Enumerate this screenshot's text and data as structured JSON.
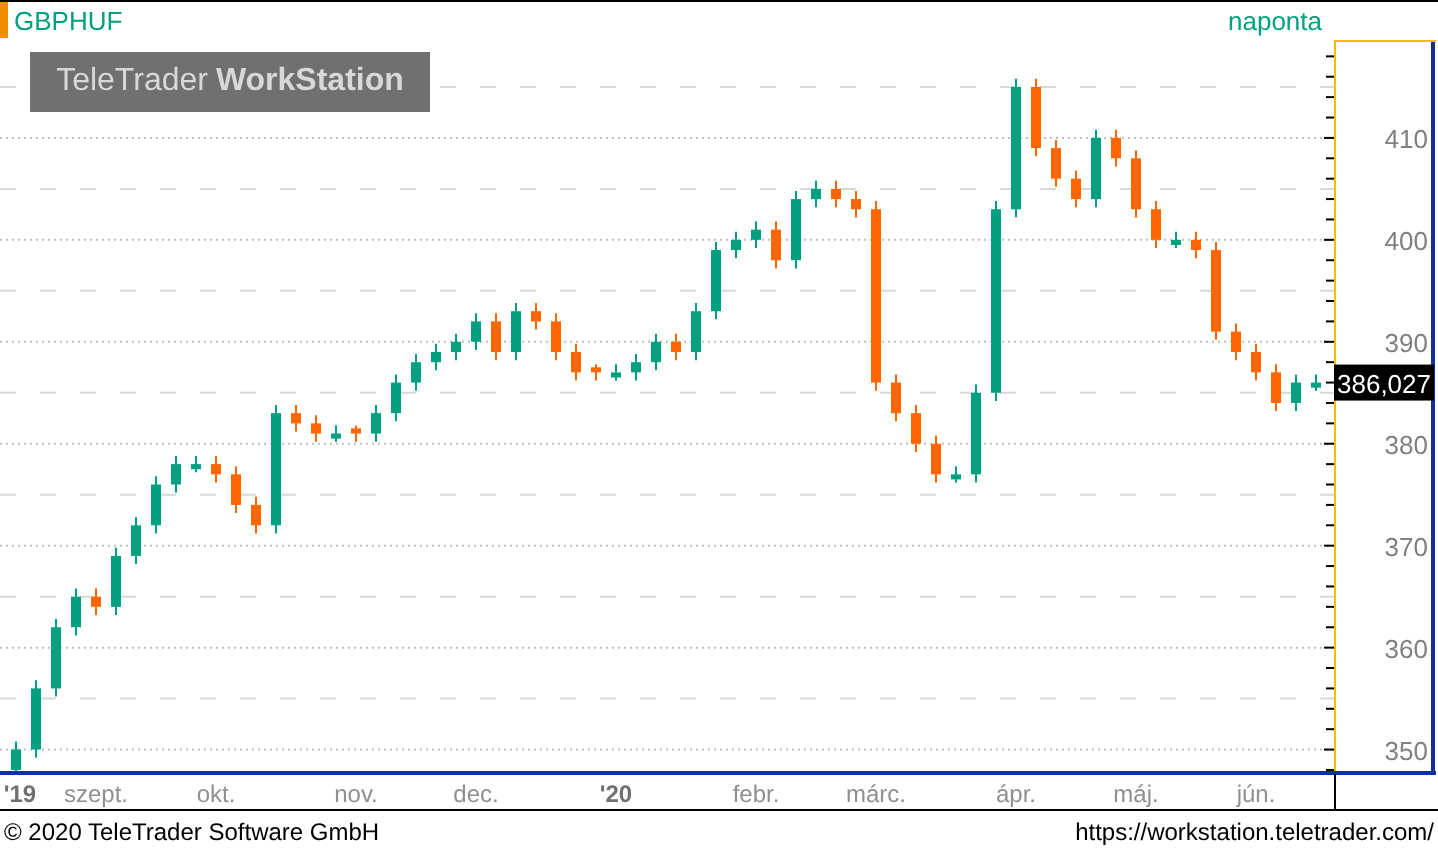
{
  "header": {
    "symbol": "GBPHUF",
    "interval": "naponta",
    "logo": {
      "brand": "TeleTrader",
      "product": "WorkStation"
    }
  },
  "chart": {
    "last_price": "386,027",
    "chart_data": {
      "type": "candlestick",
      "grid": true,
      "categories": [
        "'19",
        null,
        null,
        null,
        "szept.",
        null,
        null,
        null,
        null,
        null,
        "okt.",
        null,
        null,
        null,
        null,
        null,
        null,
        "nov.",
        null,
        null,
        null,
        null,
        null,
        "dec.",
        null,
        null,
        null,
        null,
        null,
        null,
        "'20",
        null,
        null,
        null,
        null,
        null,
        null,
        "febr.",
        null,
        null,
        null,
        null,
        null,
        "márc.",
        null,
        null,
        null,
        null,
        null,
        null,
        "ápr.",
        null,
        null,
        null,
        null,
        null,
        "máj.",
        null,
        null,
        null,
        null,
        null,
        "jún.",
        null,
        null,
        null
      ],
      "ohlc": [
        [
          348,
          350.8,
          347.8,
          350
        ],
        [
          350,
          356.8,
          349.2,
          356
        ],
        [
          356,
          362.8,
          355.2,
          362
        ],
        [
          362,
          365.8,
          361.2,
          365
        ],
        [
          365,
          365.8,
          363.2,
          364
        ],
        [
          364,
          369.8,
          363.2,
          369
        ],
        [
          369,
          372.8,
          368.2,
          372
        ],
        [
          372,
          376.8,
          371.2,
          376
        ],
        [
          376,
          378.8,
          375.2,
          378
        ],
        [
          377.5,
          378.8,
          377.2,
          378
        ],
        [
          378,
          378.8,
          376.2,
          377
        ],
        [
          377,
          377.8,
          373.2,
          374
        ],
        [
          374,
          374.8,
          371.2,
          372
        ],
        [
          372,
          383.8,
          371.2,
          383
        ],
        [
          383,
          383.8,
          381.2,
          382
        ],
        [
          382,
          382.8,
          380.2,
          381
        ],
        [
          380.5,
          381.8,
          380.2,
          381
        ],
        [
          381.5,
          381.8,
          380.2,
          381
        ],
        [
          381,
          383.8,
          380.2,
          383
        ],
        [
          383,
          386.8,
          382.2,
          386
        ],
        [
          386,
          388.8,
          385.2,
          388
        ],
        [
          388,
          389.8,
          387.2,
          389
        ],
        [
          389,
          390.8,
          388.2,
          390
        ],
        [
          390,
          392.8,
          389.2,
          392
        ],
        [
          392,
          392.8,
          388.2,
          389
        ],
        [
          389,
          393.8,
          388.2,
          393
        ],
        [
          393,
          393.8,
          391.2,
          392
        ],
        [
          392,
          392.8,
          388.2,
          389
        ],
        [
          389,
          389.8,
          386.2,
          387
        ],
        [
          387.5,
          387.8,
          386.2,
          387
        ],
        [
          386.5,
          387.8,
          386.2,
          387
        ],
        [
          387,
          388.8,
          386.2,
          388
        ],
        [
          388,
          390.8,
          387.2,
          390
        ],
        [
          390,
          390.8,
          388.2,
          389
        ],
        [
          389,
          393.8,
          388.2,
          393
        ],
        [
          393,
          399.8,
          392.2,
          399
        ],
        [
          399,
          400.8,
          398.2,
          400
        ],
        [
          400,
          401.8,
          399.2,
          401
        ],
        [
          401,
          401.8,
          397.2,
          398
        ],
        [
          398,
          404.8,
          397.2,
          404
        ],
        [
          404,
          405.8,
          403.2,
          405
        ],
        [
          405,
          405.8,
          403.2,
          404
        ],
        [
          404,
          404.8,
          402.2,
          403
        ],
        [
          403,
          403.8,
          385.2,
          386
        ],
        [
          386,
          386.8,
          382.2,
          383
        ],
        [
          383,
          383.8,
          379.2,
          380
        ],
        [
          380,
          380.8,
          376.2,
          377
        ],
        [
          376.5,
          377.8,
          376.2,
          377
        ],
        [
          377,
          385.8,
          376.2,
          385
        ],
        [
          385,
          403.8,
          384.2,
          403
        ],
        [
          403,
          415.8,
          402.2,
          415
        ],
        [
          415,
          415.8,
          408.2,
          409
        ],
        [
          409,
          409.8,
          405.2,
          406
        ],
        [
          406,
          406.8,
          403.2,
          404
        ],
        [
          404,
          410.8,
          403.2,
          410
        ],
        [
          410,
          410.8,
          407.2,
          408
        ],
        [
          408,
          408.8,
          402.2,
          403
        ],
        [
          403,
          403.8,
          399.2,
          400
        ],
        [
          399.5,
          400.8,
          399.2,
          400
        ],
        [
          400,
          400.8,
          398.2,
          399
        ],
        [
          399,
          399.8,
          390.2,
          391
        ],
        [
          391,
          391.8,
          388.2,
          389
        ],
        [
          389,
          389.8,
          386.2,
          387
        ],
        [
          387,
          387.8,
          383.2,
          384
        ],
        [
          384,
          386.8,
          383.2,
          386
        ],
        [
          385.5,
          386.8,
          385.2,
          386
        ]
      ],
      "ylim": [
        347.8,
        419.8
      ],
      "yticks": [
        {
          "value": 350,
          "label": "350"
        },
        {
          "value": 360,
          "label": "360"
        },
        {
          "value": 370,
          "label": "370"
        },
        {
          "value": 380,
          "label": "380"
        },
        {
          "value": 390,
          "label": "390"
        },
        {
          "value": 400,
          "label": "400"
        },
        {
          "value": 410,
          "label": "410"
        }
      ]
    }
  },
  "footer": {
    "copyright": "© 2020 TeleTrader Software GmbH",
    "url": "https://workstation.teletrader.com/"
  }
}
